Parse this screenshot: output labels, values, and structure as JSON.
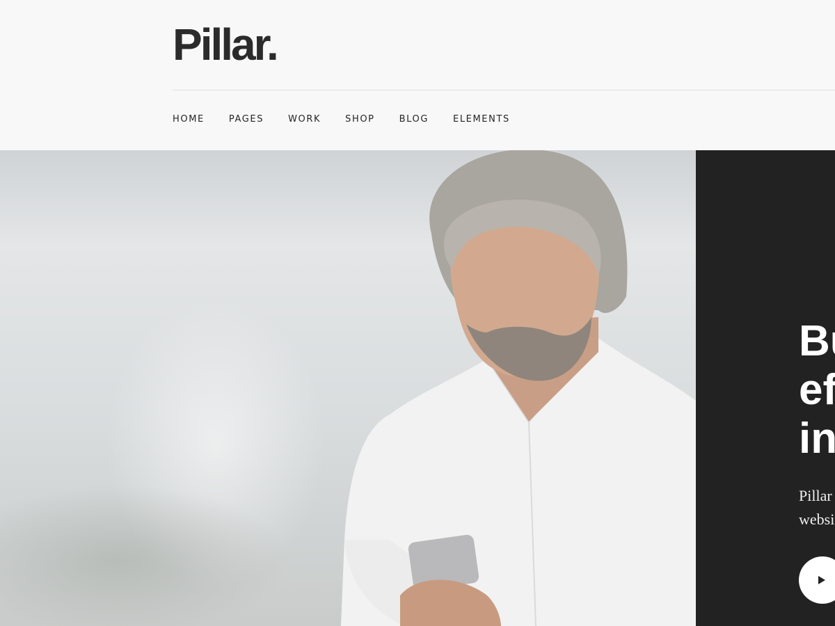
{
  "brand": {
    "logo_text": "Pillar."
  },
  "nav": {
    "items": [
      {
        "label": "HOME"
      },
      {
        "label": "PAGES"
      },
      {
        "label": "WORK"
      },
      {
        "label": "SHOP"
      },
      {
        "label": "BLOG"
      },
      {
        "label": "ELEMENTS"
      }
    ]
  },
  "hero": {
    "image_icon": "man-with-smartphone-photo",
    "panel": {
      "heading_lines": [
        "Bu",
        "ef",
        "in"
      ],
      "text_lines": [
        "Pillar",
        "websi"
      ],
      "play_icon": "play-icon"
    }
  },
  "colors": {
    "header_bg": "#f8f8f8",
    "panel_bg": "#222222",
    "text_dark": "#252525"
  }
}
